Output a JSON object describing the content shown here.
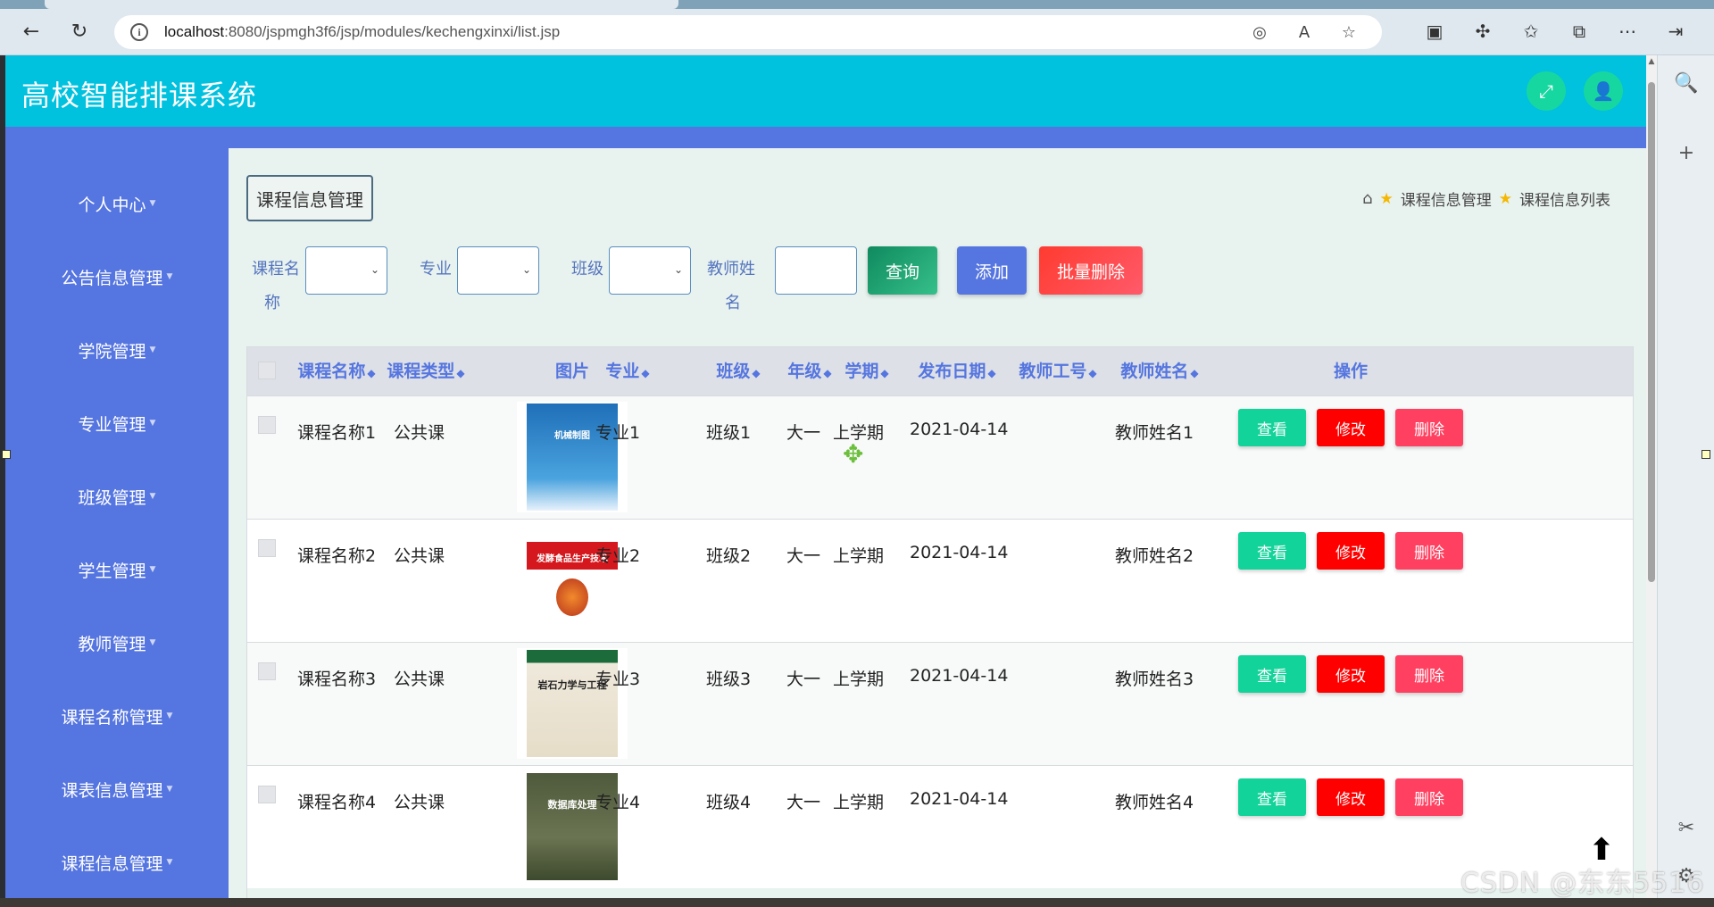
{
  "browser": {
    "url_host": "localhost",
    "url_rest": ":8080/jspmgh3f6/jsp/modules/kechengxinxi/list.jsp"
  },
  "app": {
    "title": "高校智能排课系统"
  },
  "sidebar": {
    "items": [
      {
        "label": "个人中心"
      },
      {
        "label": "公告信息管理"
      },
      {
        "label": "学院管理"
      },
      {
        "label": "专业管理"
      },
      {
        "label": "班级管理"
      },
      {
        "label": "学生管理"
      },
      {
        "label": "教师管理"
      },
      {
        "label": "课程名称管理"
      },
      {
        "label": "课表信息管理"
      },
      {
        "label": "课程信息管理"
      }
    ]
  },
  "page": {
    "section_button": "课程信息管理",
    "breadcrumb": [
      "课程信息管理",
      "课程信息列表"
    ]
  },
  "search": {
    "course_name_label_1": "课程名",
    "course_name_label_2": "称",
    "major_label": "专业",
    "class_label": "班级",
    "teacher_label_1": "教师姓",
    "teacher_label_2": "名",
    "query_button": "查询",
    "add_button": "添加",
    "batch_delete_button": "批量删除"
  },
  "table": {
    "headers": {
      "course_name": "课程名称",
      "course_type": "课程类型",
      "image": "图片",
      "major": "专业",
      "class": "班级",
      "grade": "年级",
      "semester": "学期",
      "publish_date": "发布日期",
      "teacher_id": "教师工号",
      "teacher_name": "教师姓名",
      "actions": "操作"
    },
    "rows": [
      {
        "course_name": "课程名称1",
        "course_type": "公共课",
        "major": "专业1",
        "class": "班级1",
        "grade": "大一",
        "semester": "上学期",
        "publish_date": "2021-04-14",
        "teacher_id": "",
        "teacher_name": "教师姓名1",
        "book_title": "机械制图"
      },
      {
        "course_name": "课程名称2",
        "course_type": "公共课",
        "major": "专业2",
        "class": "班级2",
        "grade": "大一",
        "semester": "上学期",
        "publish_date": "2021-04-14",
        "teacher_id": "",
        "teacher_name": "教师姓名2",
        "book_title": "发酵食品生产技术"
      },
      {
        "course_name": "课程名称3",
        "course_type": "公共课",
        "major": "专业3",
        "class": "班级3",
        "grade": "大一",
        "semester": "上学期",
        "publish_date": "2021-04-14",
        "teacher_id": "",
        "teacher_name": "教师姓名3",
        "book_title": "岩石力学与工程"
      },
      {
        "course_name": "课程名称4",
        "course_type": "公共课",
        "major": "专业4",
        "class": "班级4",
        "grade": "大一",
        "semester": "上学期",
        "publish_date": "2021-04-14",
        "teacher_id": "",
        "teacher_name": "教师姓名4",
        "book_title": "数据库处理"
      }
    ],
    "action_labels": {
      "view": "查看",
      "edit": "修改",
      "delete": "删除"
    }
  },
  "watermark": "CSDN @东东5516",
  "colors": {
    "header": "#00c1de",
    "sidebar": "#5575e0",
    "query": "#1e9b6a",
    "add": "#5575e0",
    "batch_delete": "#ff4a4a",
    "view": "#12d39a",
    "edit": "#ff0000",
    "delete": "#ff4060"
  }
}
